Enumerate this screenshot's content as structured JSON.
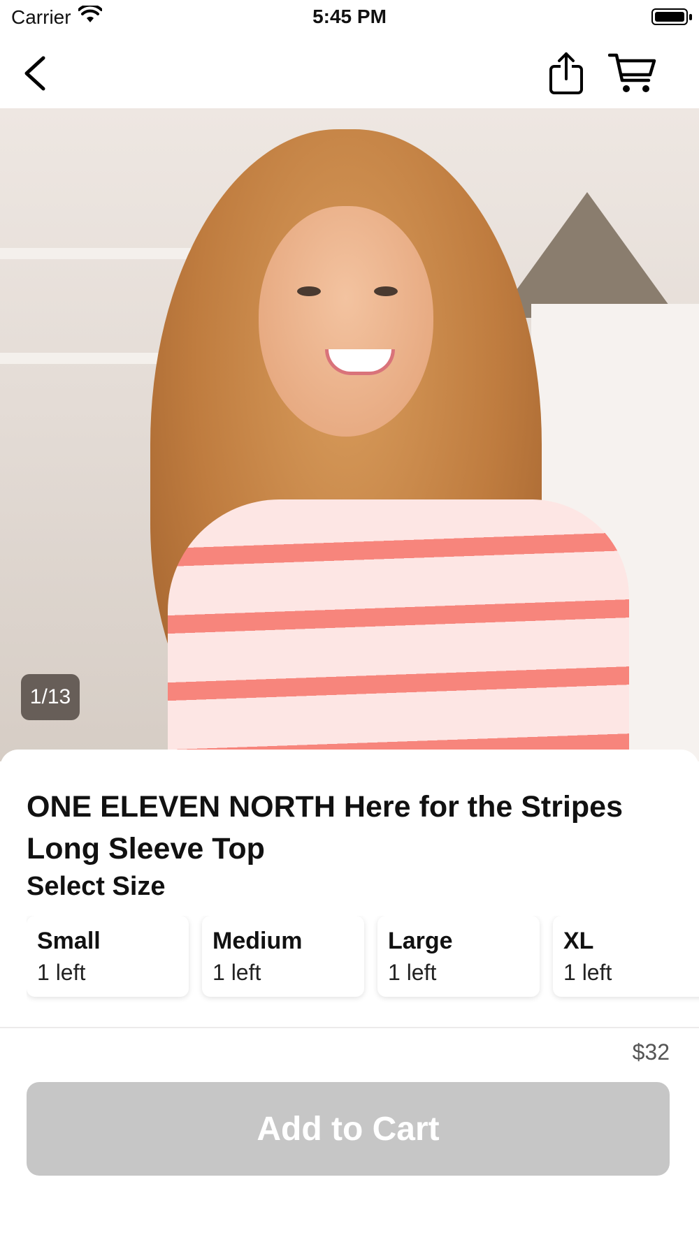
{
  "status_bar": {
    "carrier": "Carrier",
    "time": "5:45 PM"
  },
  "nav": {
    "back_icon": "chevron-left-icon",
    "share_icon": "share-icon",
    "cart_icon": "cart-icon"
  },
  "gallery": {
    "counter": "1/13"
  },
  "product": {
    "title": "ONE ELEVEN NORTH Here for the Stripes Long Sleeve Top",
    "select_size_label": "Select Size",
    "sizes": [
      {
        "name": "Small",
        "stock": "1 left"
      },
      {
        "name": "Medium",
        "stock": "1 left"
      },
      {
        "name": "Large",
        "stock": "1 left"
      },
      {
        "name": "XL",
        "stock": "1 left"
      }
    ],
    "price": "$32"
  },
  "actions": {
    "add_to_cart_label": "Add to Cart"
  },
  "colors": {
    "button_disabled": "#c6c6c6",
    "stripe_accent": "#f7857c"
  }
}
